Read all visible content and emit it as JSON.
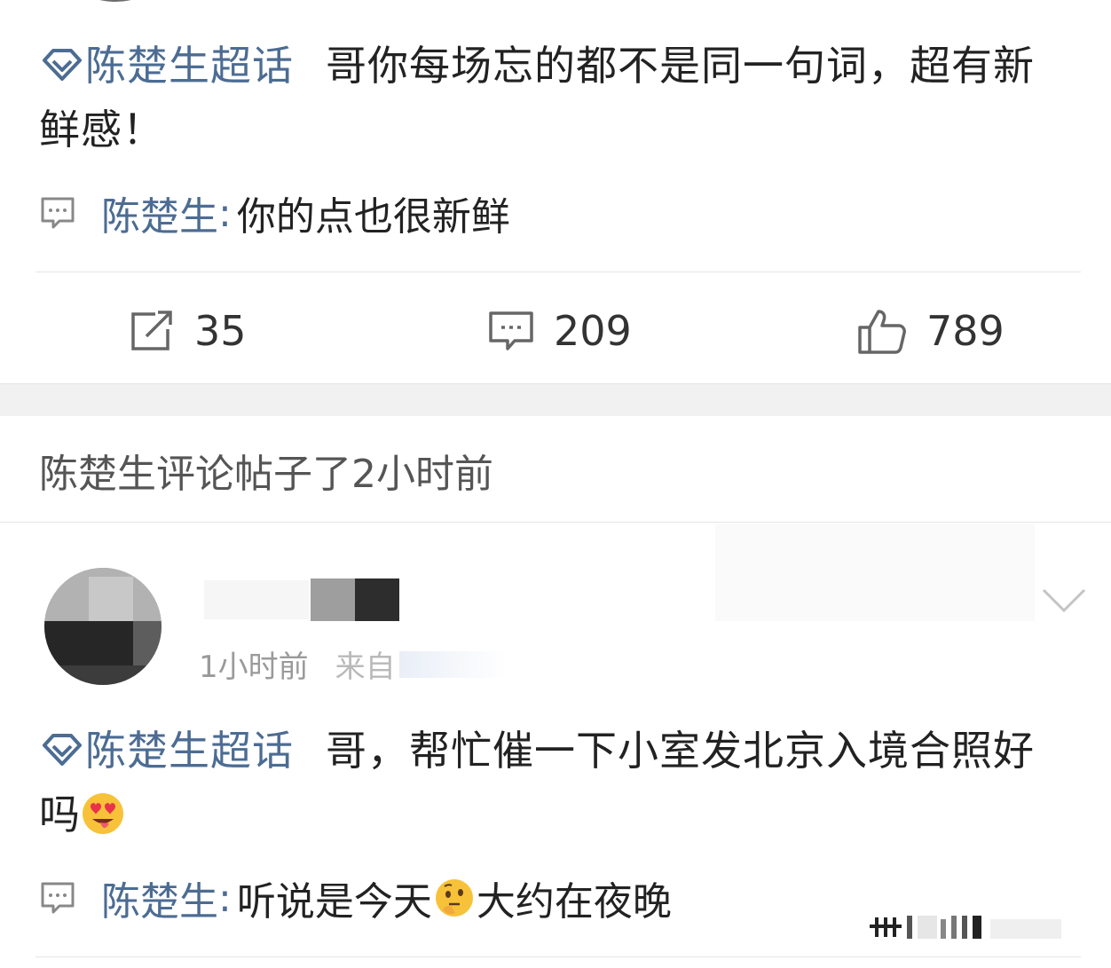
{
  "post1": {
    "topic": "陈楚生超话",
    "text": "哥你每场忘的都不是同一句词，超有新鲜感！",
    "reply": {
      "author": "陈楚生",
      "colon": ":",
      "text": "你的点也很新鲜"
    }
  },
  "actions": {
    "share_count": "35",
    "comment_count": "209",
    "like_count": "789"
  },
  "activity": {
    "text": "陈楚生评论帖子了2小时前"
  },
  "post2": {
    "time": "1小时前",
    "source": "来自",
    "topic": "陈楚生超话",
    "text": "哥，帮忙催一下小室发北京入境合照好吗",
    "reply": {
      "author": "陈楚生",
      "colon": ":",
      "text_before_emoji": "听说是今天",
      "text_after_emoji": "大约在夜晚"
    }
  },
  "icons": {
    "topic": "diamond-icon",
    "reply": "comment-bubble-icon",
    "share": "share-icon",
    "comment": "comment-icon",
    "like": "thumbs-up-icon",
    "more": "chevron-down-icon",
    "emoji1": "heart-eyes-tongue-emoji",
    "emoji2": "thinking-face-emoji"
  },
  "colors": {
    "link": "#4c6c93",
    "text": "#222222",
    "muted": "#9a9a9a",
    "separator": "#f1f1f1"
  }
}
